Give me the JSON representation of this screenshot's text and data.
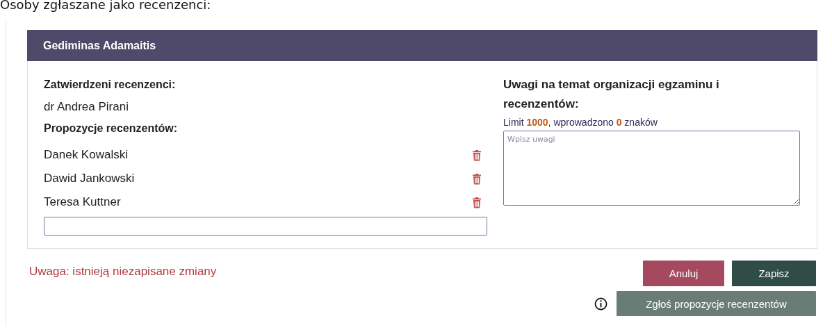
{
  "page_heading": "Osoby zgłaszane jako recenzenci:",
  "card": {
    "title": "Gediminas Adamaitis",
    "approved": {
      "heading": "Zatwierdzeni recenzenci:",
      "names": [
        "dr Andrea Pirani"
      ]
    },
    "proposals": {
      "heading": "Propozycje recenzentów:",
      "names": [
        "Danek Kowalski",
        "Dawid Jankowski",
        "Teresa Kuttner"
      ],
      "entry_field_shown": true
    },
    "remarks": {
      "heading": "Uwagi na temat organizacji egzaminu i recenzentów:",
      "counter": "Limit **1000**, wprowadzono **0** znaków",
      "placeholder": "Wpisz uwagi"
    }
  },
  "warning": "Uwaga: istnieją niezapisane zmiany",
  "buttons": [
    {
      "label": "Anuluj",
      "kind": "cancel"
    },
    {
      "label": "Zapisz",
      "kind": "save"
    }
  ],
  "submit_button": {
    "label": "Zgłoś propozycje recenzentów",
    "disabled": true
  }
}
